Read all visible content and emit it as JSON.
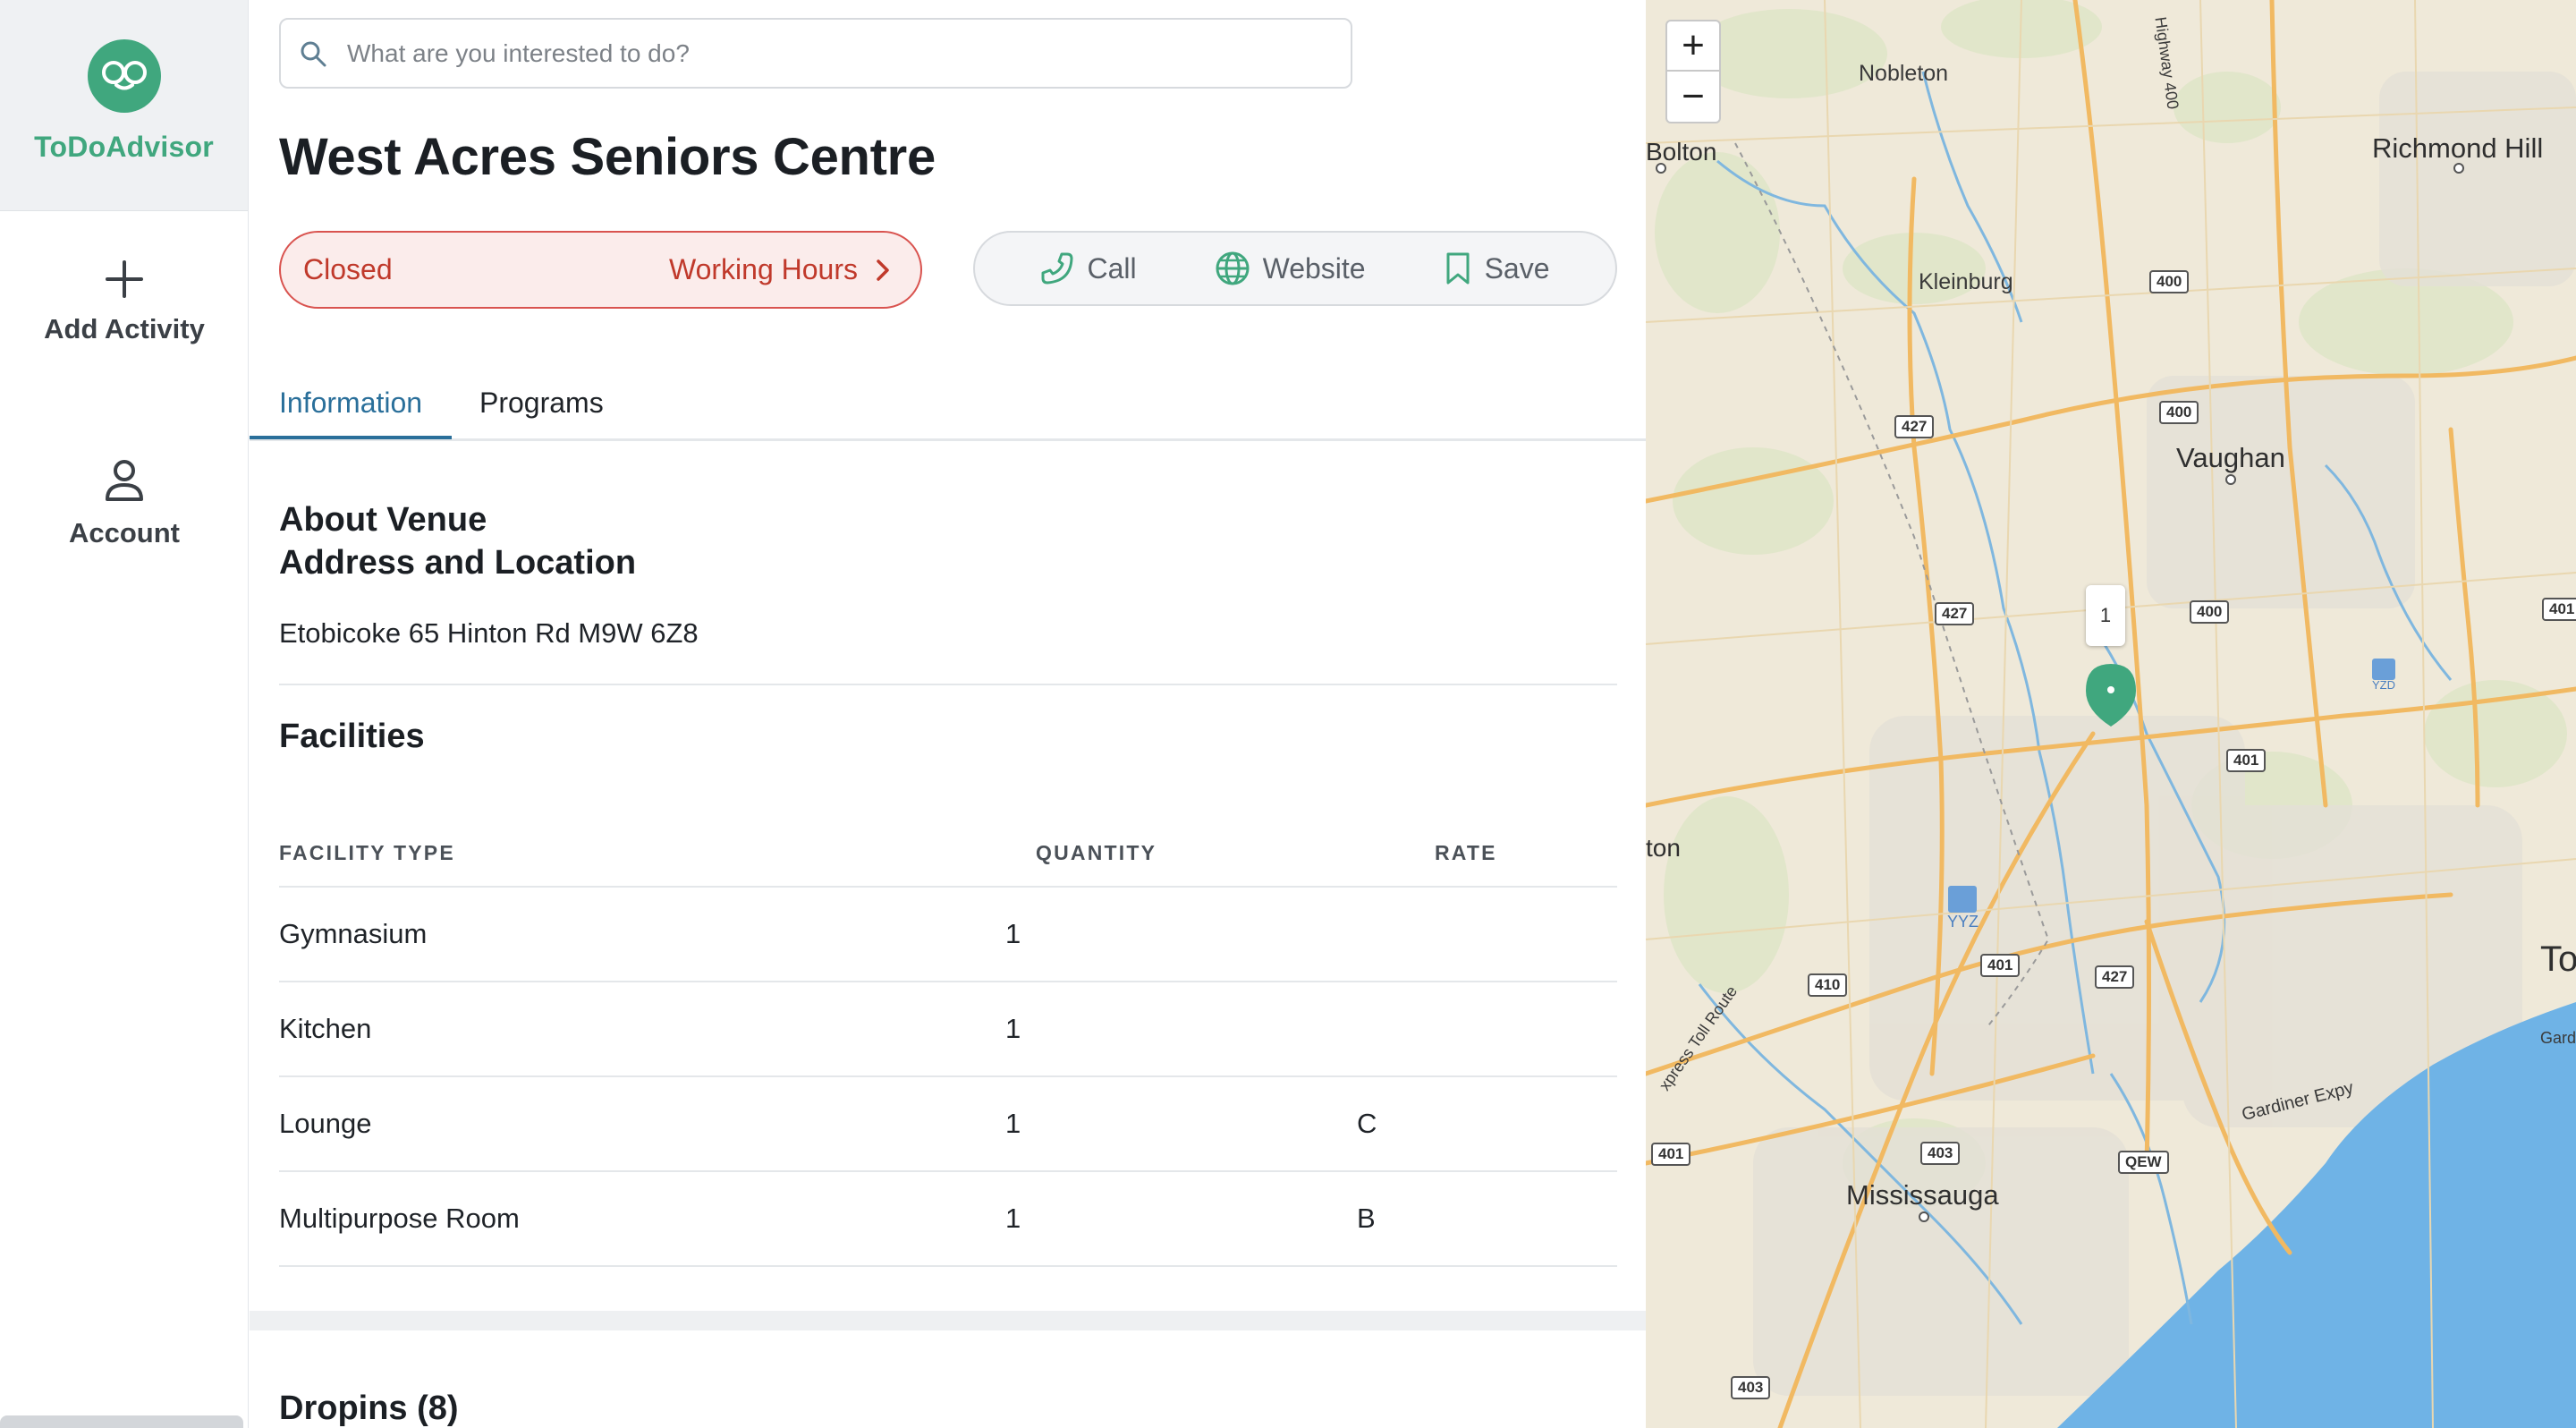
{
  "brand": {
    "name": "ToDoAdvisor"
  },
  "nav": {
    "add_activity": "Add Activity",
    "account": "Account"
  },
  "search": {
    "placeholder": "What are you interested to do?"
  },
  "venue": {
    "name": "West Acres Seniors Centre",
    "status": "Closed",
    "hours_link": "Working Hours",
    "actions": {
      "call": "Call",
      "website": "Website",
      "save": "Save"
    }
  },
  "tabs": {
    "information": "Information",
    "programs": "Programs"
  },
  "about": {
    "heading": "About Venue",
    "address_heading": "Address and Location",
    "address": "Etobicoke 65 Hinton Rd M9W 6Z8"
  },
  "facilities": {
    "heading": "Facilities",
    "columns": [
      "FACILITY TYPE",
      "QUANTITY",
      "RATE"
    ],
    "rows": [
      {
        "type": "Gymnasium",
        "quantity": "1",
        "rate": ""
      },
      {
        "type": "Kitchen",
        "quantity": "1",
        "rate": ""
      },
      {
        "type": "Lounge",
        "quantity": "1",
        "rate": "C"
      },
      {
        "type": "Multipurpose Room",
        "quantity": "1",
        "rate": "B"
      }
    ]
  },
  "dropins": {
    "heading": "Dropins (8)"
  },
  "map": {
    "zoom_in": "+",
    "zoom_out": "−",
    "cluster_count": "1",
    "places": {
      "nobleton": "Nobleton",
      "bolton": "Bolton",
      "richmond_hill": "Richmond Hill",
      "kleinburg": "Kleinburg",
      "vaughan": "Vaughan",
      "ton": "ton",
      "mississauga": "Mississauga",
      "to": "To",
      "yyz": "YYZ",
      "yzd": "YZD",
      "gardiner": "Gardiner Expy",
      "highway400": "Highway 400",
      "toll_route": "xpress Toll Route",
      "gardi": "Gardi"
    },
    "shields": [
      "400",
      "400",
      "427",
      "427",
      "400",
      "401",
      "401",
      "410",
      "427",
      "401",
      "403",
      "QEW",
      "403",
      "401"
    ],
    "colors": {
      "land": "#efe9d9",
      "water": "#6fb3e6",
      "road": "#f1b962",
      "pin": "#40a77e"
    }
  },
  "colors": {
    "brand": "#40a77e",
    "closed": "#c0392b",
    "tab_active": "#2a6f9a"
  }
}
